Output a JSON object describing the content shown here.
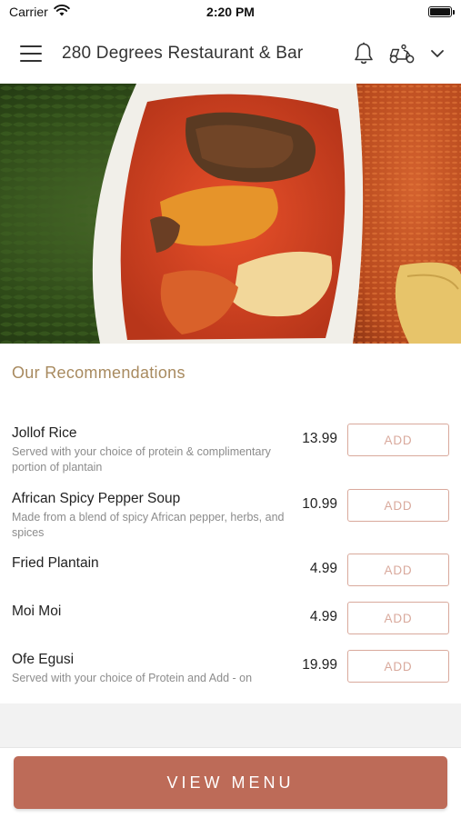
{
  "status_bar": {
    "carrier": "Carrier",
    "time": "2:20 PM"
  },
  "header": {
    "title": "280 Degrees Restaurant & Bar",
    "icons": [
      "menu-icon",
      "bell-icon",
      "delivery-scooter-icon",
      "chevron-down-icon"
    ]
  },
  "hero": {
    "alt": "Dish photo: stew with fish in tomato sauce, greens and jollof rice with plantain"
  },
  "recommendations": {
    "title": "Our Recommendations",
    "add_label": "ADD",
    "items": [
      {
        "name": "Jollof Rice",
        "description": "Served with your choice of protein & complimentary portion of plantain",
        "price": "13.99"
      },
      {
        "name": "African Spicy Pepper Soup",
        "description": "Made from a blend of spicy African pepper, herbs, and spices",
        "price": "10.99"
      },
      {
        "name": "Fried Plantain",
        "description": "",
        "price": "4.99"
      },
      {
        "name": "Moi Moi",
        "description": "",
        "price": "4.99"
      },
      {
        "name": "Ofe Egusi",
        "description": "Served with your choice of Protein and Add - on",
        "price": "19.99"
      }
    ]
  },
  "footer": {
    "view_menu_label": "VIEW MENU"
  },
  "colors": {
    "accent": "#bd6b58",
    "add_border": "#d9a99c",
    "section_title": "#a88a5f"
  }
}
